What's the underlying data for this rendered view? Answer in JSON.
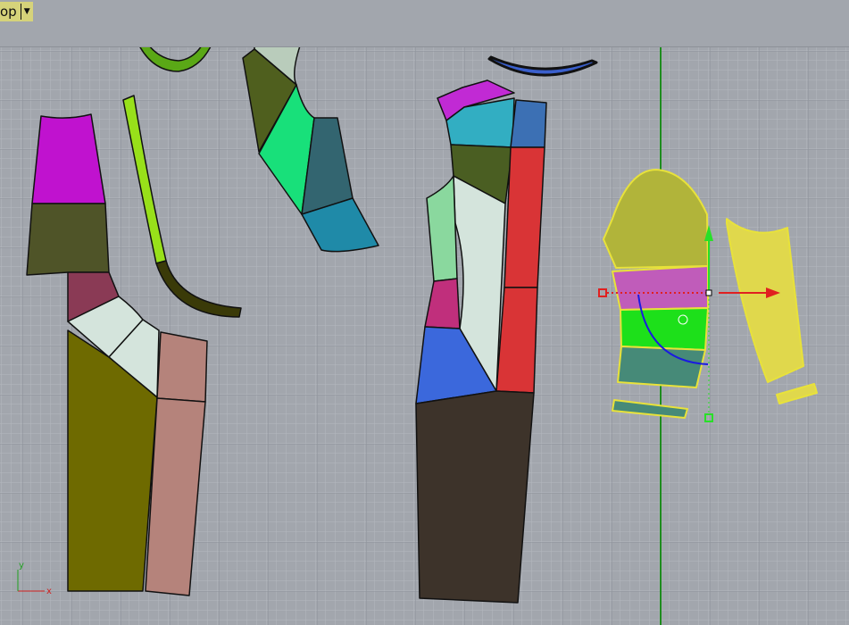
{
  "viewport": {
    "name": "op",
    "dropdown_icon": "triangle-down"
  },
  "axes": {
    "x_label": "x",
    "y_label": "y"
  },
  "colors": {
    "grid_bg": "#a2a6ad",
    "minor": "#b3b7be",
    "major": "#8e939a",
    "selection": "#e8e23a",
    "y_axis": "#1e8c1e"
  }
}
